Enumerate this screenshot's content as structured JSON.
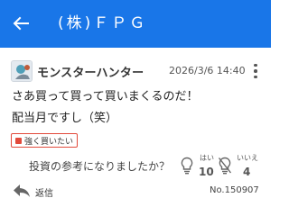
{
  "header": {
    "title": "(株)ＦＰＧ",
    "background": "#1976e8"
  },
  "post": {
    "username": "モンスターハンター",
    "datetime": "2026/3/6 14:40",
    "lines": [
      "さあ買って買って買いまくるのだ！",
      "配当月ですし（笑）"
    ],
    "tag": {
      "label": "強く買いたい",
      "color": "#e24a3b"
    },
    "question": "投資の参考になりましたか？",
    "votes": {
      "yes": {
        "label": "はい",
        "count": "10",
        "icon": "lightbulb-icon"
      },
      "no": {
        "label": "いいえ",
        "count": "4",
        "icon": "lightbulb-off-icon"
      }
    },
    "reply_label": "返信",
    "post_number": "No.150907"
  }
}
